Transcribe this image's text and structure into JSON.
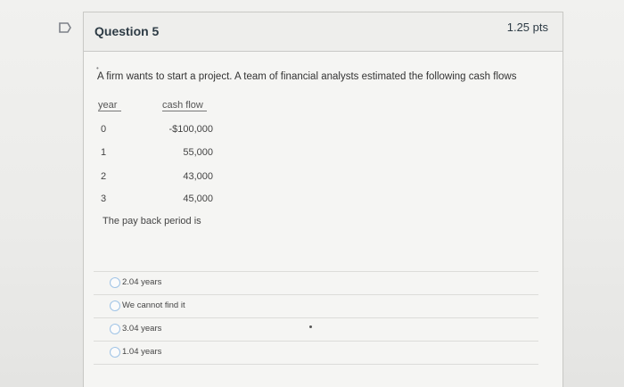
{
  "question": {
    "title": "Question 5",
    "points": "1.25 pts",
    "prompt": "A firm wants to start a project. A team of financial analysts estimated the following cash flows",
    "table": {
      "headers": {
        "year": "year",
        "cash_flow": "cash flow"
      },
      "rows": [
        {
          "year": "0",
          "cash_flow": "-$100,000"
        },
        {
          "year": "1",
          "cash_flow": "55,000"
        },
        {
          "year": "2",
          "cash_flow": "43,000"
        },
        {
          "year": "3",
          "cash_flow": "45,000"
        }
      ]
    },
    "stem": "The pay back period is",
    "answers": [
      {
        "label": "2.04 years"
      },
      {
        "label": "We cannot find it"
      },
      {
        "label": "3.04 years"
      },
      {
        "label": "1.04 years"
      }
    ]
  },
  "icons": {
    "flag": "flag-icon",
    "radio": "radio-icon"
  },
  "colors": {
    "title": "#2d3b45",
    "radio_border": "#9fc3e6",
    "divider": "#dcdcd9"
  }
}
